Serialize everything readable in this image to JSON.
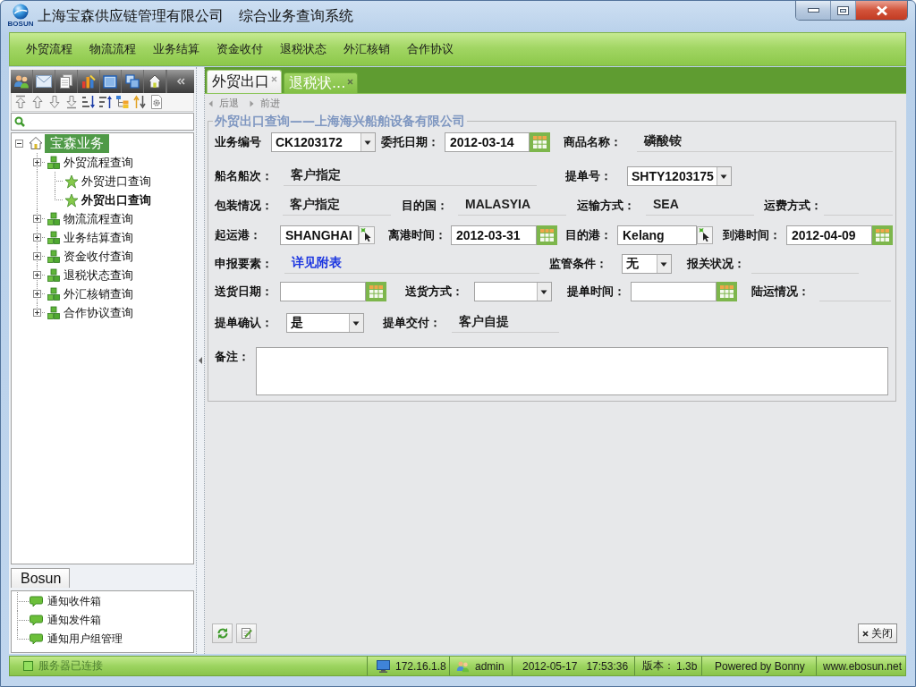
{
  "window": {
    "logo_text": "BOSUN",
    "title": "上海宝森供应链管理有限公司",
    "subtitle": "综合业务查询系统"
  },
  "menu": [
    "外贸流程",
    "物流流程",
    "业务结算",
    "资金收付",
    "退税状态",
    "外汇核销",
    "合作协议"
  ],
  "sidebar": {
    "tree": [
      {
        "label": "宝森业务",
        "kind": "root",
        "expanded": true,
        "selected": true,
        "children": [
          {
            "label": "外贸流程查询",
            "kind": "folder",
            "expanded": false,
            "selected": false,
            "children": [
              {
                "label": "外贸进口查询",
                "kind": "page",
                "selected": false,
                "active": false
              },
              {
                "label": "外贸出口查询",
                "kind": "page",
                "selected": false,
                "active": true
              }
            ]
          },
          {
            "label": "物流流程查询",
            "kind": "folder",
            "expanded": false,
            "selected": false
          },
          {
            "label": "业务结算查询",
            "kind": "folder",
            "expanded": false,
            "selected": false
          },
          {
            "label": "资金收付查询",
            "kind": "folder",
            "expanded": false,
            "selected": false
          },
          {
            "label": "退税状态查询",
            "kind": "folder",
            "expanded": false,
            "selected": false
          },
          {
            "label": "外汇核销查询",
            "kind": "folder",
            "expanded": false,
            "selected": false
          },
          {
            "label": "合作协议查询",
            "kind": "folder",
            "expanded": false,
            "selected": false
          }
        ]
      }
    ],
    "panel_tab": {
      "label": "Bosun",
      "selected": true
    },
    "notifications": [
      "通知收件箱",
      "通知发件箱",
      "通知用户组管理"
    ]
  },
  "tabs": [
    {
      "label": "外贸出口",
      "selected": true
    },
    {
      "label": "退税状...",
      "selected": false
    }
  ],
  "toolbar": [
    {
      "label": "后退",
      "kind": "back",
      "disabled": true
    },
    {
      "label": "前进",
      "kind": "forward",
      "disabled": true
    }
  ],
  "form": {
    "legend": "外贸出口查询——上海海兴船舶设备有限公司",
    "rows": [
      [
        {
          "kind": "combo",
          "label": "业务编号",
          "value": "CK1203172"
        },
        {
          "kind": "date",
          "label": "委托日期：",
          "value": "2012-03-14"
        },
        {
          "kind": "text",
          "label": "商品名称：",
          "value": "磷酸铵"
        }
      ],
      [
        {
          "kind": "text",
          "label": "船名船次：",
          "value": "客户指定"
        },
        {
          "kind": "combo",
          "label": "提单号：",
          "value": "SHTY1203175"
        }
      ],
      [
        {
          "kind": "text",
          "label": "包装情况：",
          "value": "客户指定"
        },
        {
          "kind": "text",
          "label": "目的国：",
          "value": "MALASYIA"
        },
        {
          "kind": "text",
          "label": "运输方式：",
          "value": "SEA"
        },
        {
          "kind": "text",
          "label": "运费方式："
        }
      ],
      [
        {
          "kind": "picker",
          "label": "起运港：",
          "value": "SHANGHAI"
        },
        {
          "kind": "date",
          "label": "离港时间：",
          "value": "2012-03-31"
        },
        {
          "kind": "picker",
          "label": "目的港：",
          "value": "Kelang"
        },
        {
          "kind": "date",
          "label": "到港时间：",
          "value": "2012-04-09"
        }
      ],
      [
        {
          "kind": "link",
          "label": "申报要素：",
          "value": "详见附表"
        },
        {
          "kind": "combo",
          "label": "监管条件：",
          "value": "无"
        },
        {
          "kind": "text",
          "label": "报关状况："
        }
      ],
      [
        {
          "kind": "date",
          "label": "送货日期："
        },
        {
          "kind": "combo",
          "label": "送货方式："
        },
        {
          "kind": "date",
          "label": "提单时间："
        },
        {
          "kind": "text",
          "label": "陆运情况："
        }
      ],
      [
        {
          "kind": "combo",
          "label": "提单确认：",
          "value": "是"
        },
        {
          "kind": "text",
          "label": "提单交付：",
          "value": "客户自提"
        }
      ],
      [
        {
          "kind": "textarea",
          "label": "备注："
        }
      ]
    ]
  },
  "footer": {
    "close_label": "关闭"
  },
  "status_bar": {
    "connection": "服务器已连接",
    "ip": "172.16.1.8",
    "user": "admin",
    "date": "2012-05-17",
    "time": "17:53:36",
    "version_label": "版本：",
    "version": "1.3b",
    "credit": "Powered by Bonny",
    "website": "www.ebosun.net"
  }
}
